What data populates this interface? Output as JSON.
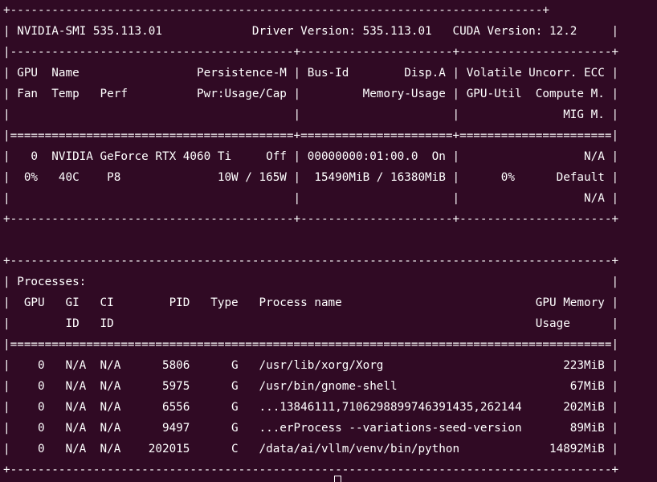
{
  "terminal": {
    "background": "#300a24",
    "foreground": "#ffffff",
    "lines": [
      "+-----------------------------------------------------------------------------+",
      "| NVIDIA-SMI 535.113.01             Driver Version: 535.113.01   CUDA Version: 12.2     |",
      "|-----------------------------------------+----------------------+----------------------+",
      "| GPU  Name                 Persistence-M | Bus-Id        Disp.A | Volatile Uncorr. ECC |",
      "| Fan  Temp   Perf          Pwr:Usage/Cap |         Memory-Usage | GPU-Util  Compute M. |",
      "|                                         |                      |               MIG M. |",
      "|=========================================+======================+======================|",
      "|   0  NVIDIA GeForce RTX 4060 Ti     Off | 00000000:01:00.0  On |                  N/A |",
      "|  0%   40C    P8              10W / 165W |  15490MiB / 16380MiB |      0%      Default |",
      "|                                         |                      |                  N/A |",
      "+-----------------------------------------+----------------------+----------------------+",
      "",
      "",
      "+---------------------------------------------------------------------------------------+",
      "| Processes:                                                                            |",
      "|  GPU   GI   CI        PID   Type   Process name                            GPU Memory |",
      "|        ID   ID                                                             Usage      |",
      "|=======================================================================================|",
      "|    0   N/A  N/A      5806      G   /usr/lib/xorg/Xorg                          223MiB |",
      "|    0   N/A  N/A      5975      G   /usr/bin/gnome-shell                         67MiB |",
      "|    0   N/A  N/A      6556      G   ...13846111,7106298899746391435,262144      202MiB |",
      "|    0   N/A  N/A      9497      G   ...erProcess --variations-seed-version       89MiB |",
      "|    0   N/A  N/A    202015      C   /data/ai/vllm/venv/bin/python             14892MiB |",
      "+---------------------------------------------------------------------------------------+"
    ]
  }
}
